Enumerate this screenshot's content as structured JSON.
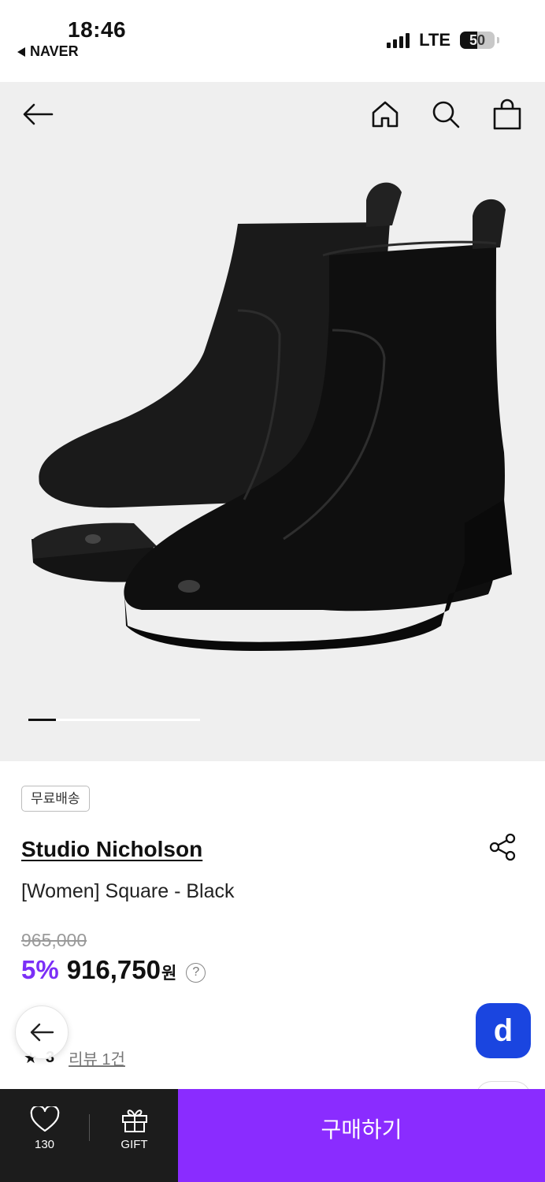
{
  "status_bar": {
    "time": "18:46",
    "back_app": "NAVER",
    "network": "LTE",
    "battery": "50"
  },
  "header": {
    "back_icon": "arrow-left-icon",
    "home_icon": "home-icon",
    "search_icon": "search-icon",
    "cart_icon": "shopping-bag-icon"
  },
  "gallery": {
    "image_alt": "Black leather square-toe ankle boots",
    "progress_fraction": 0.16
  },
  "product": {
    "badge": "무료배송",
    "brand": "Studio Nicholson",
    "name": "[Women] Square - Black",
    "original_price": "965,000",
    "discount": "5%",
    "price": "916,750",
    "currency": "원",
    "help": "?",
    "rating": "3",
    "reviews": "리뷰 1건"
  },
  "floating": {
    "back_icon": "arrow-left-icon",
    "d_button": "d"
  },
  "bottom_bar": {
    "like_count": "130",
    "gift_label": "GIFT",
    "buy_label": "구매하기"
  },
  "colors": {
    "accent": "#8a2cff",
    "discount": "#7b2ff7",
    "d_button": "#1a45e0",
    "bottom_bar": "#1c1c1c",
    "hero_bg": "#efefef"
  }
}
